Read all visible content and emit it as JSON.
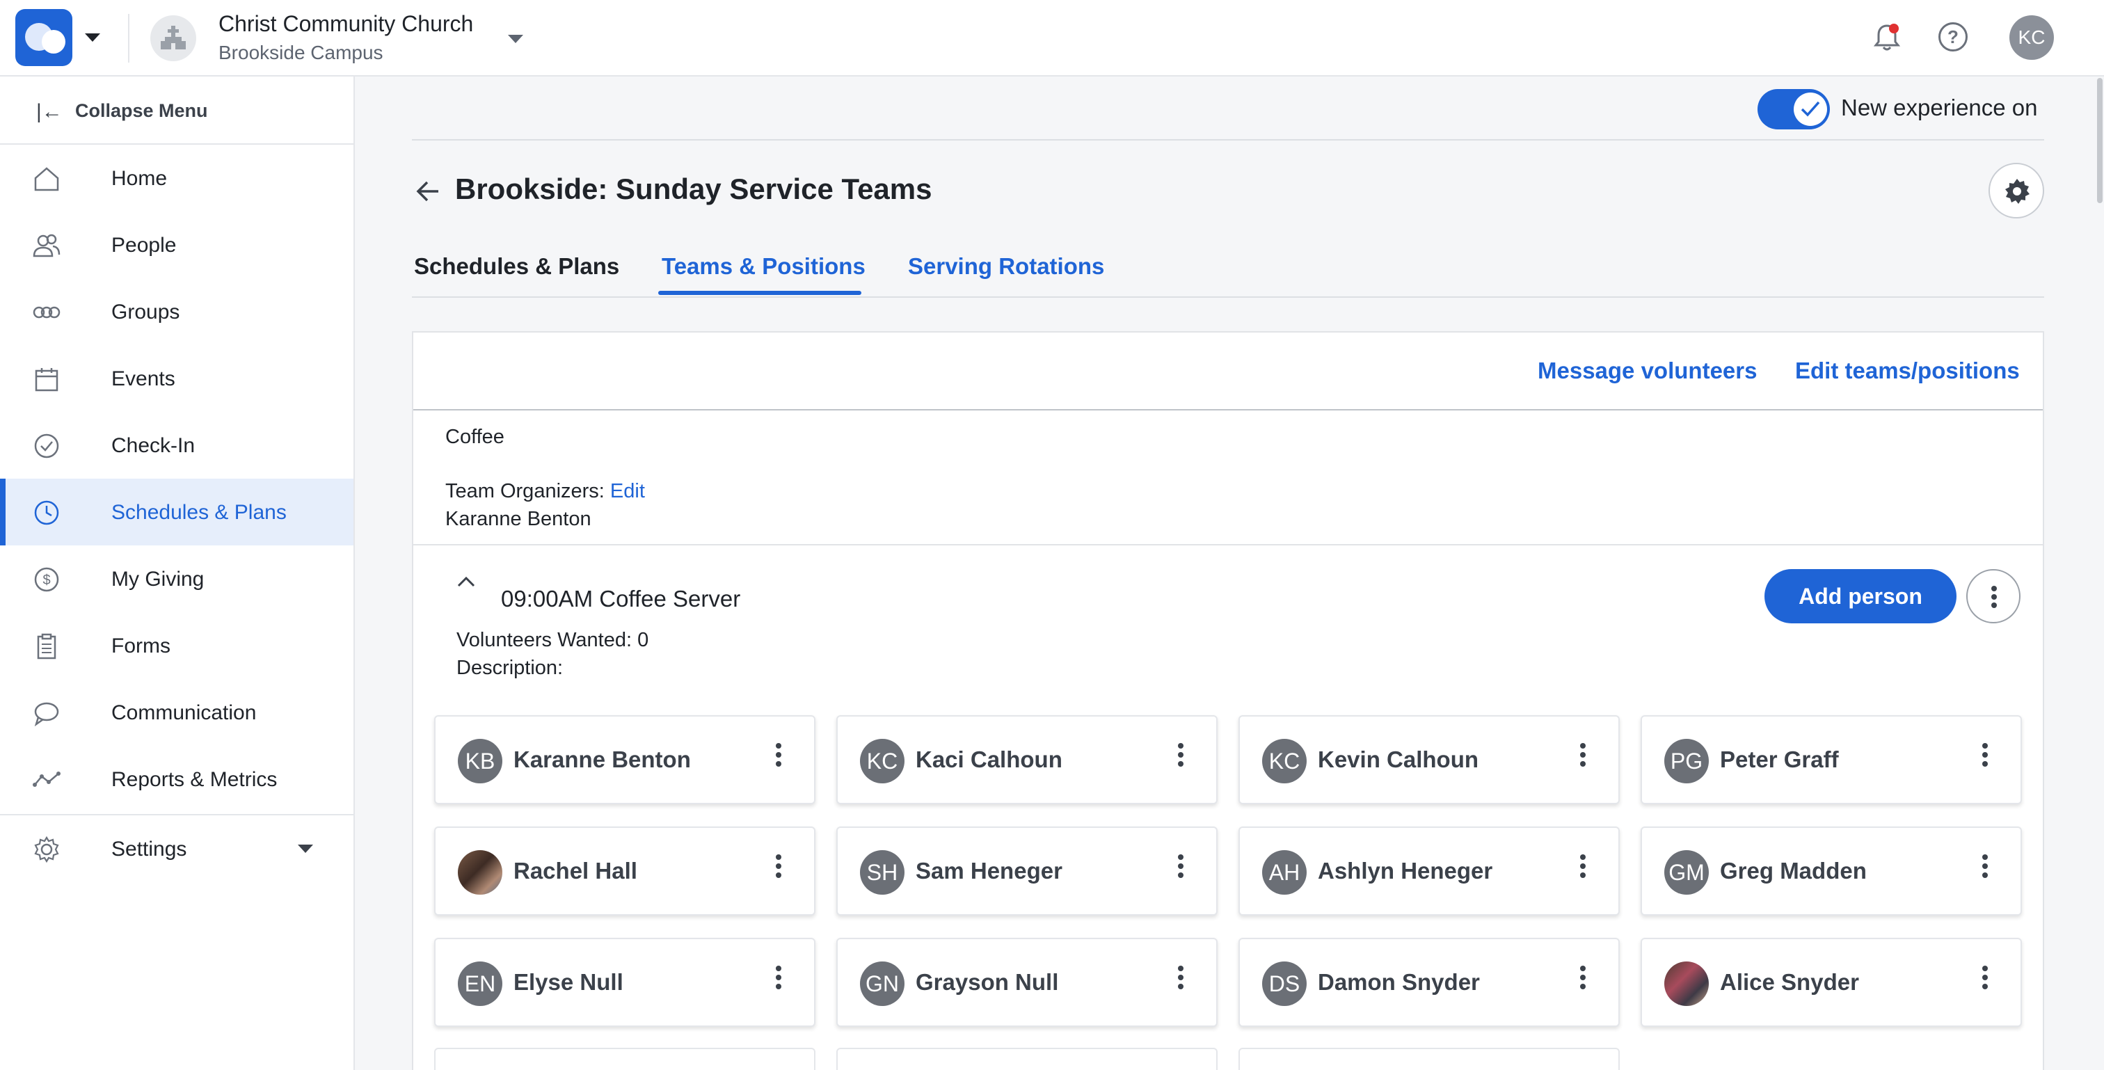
{
  "topbar": {
    "church_name": "Christ Community Church",
    "campus": "Brookside Campus",
    "user_initials": "KC",
    "notification_dot_color": "#e03131"
  },
  "sidebar": {
    "collapse_label": "Collapse Menu",
    "items": [
      {
        "label": "Home",
        "icon": "home-icon"
      },
      {
        "label": "People",
        "icon": "people-icon"
      },
      {
        "label": "Groups",
        "icon": "groups-icon"
      },
      {
        "label": "Events",
        "icon": "calendar-icon"
      },
      {
        "label": "Check-In",
        "icon": "check-circle-icon"
      },
      {
        "label": "Schedules & Plans",
        "icon": "clock-icon",
        "active": true
      },
      {
        "label": "My Giving",
        "icon": "dollar-icon"
      },
      {
        "label": "Forms",
        "icon": "clipboard-icon"
      },
      {
        "label": "Communication",
        "icon": "chat-icon"
      },
      {
        "label": "Reports & Metrics",
        "icon": "metrics-icon"
      }
    ],
    "settings_label": "Settings"
  },
  "main": {
    "toggle_label": "New experience on",
    "toggle_on": true,
    "title": "Brookside: Sunday Service Teams",
    "tabs": [
      {
        "label": "Schedules & Plans"
      },
      {
        "label": "Teams & Positions",
        "active": true
      },
      {
        "label": "Serving Rotations"
      }
    ],
    "actions": {
      "message": "Message volunteers",
      "edit": "Edit teams/positions"
    },
    "team": {
      "name": "Coffee",
      "organizers_label": "Team Organizers:",
      "organizers_edit": "Edit",
      "organizer_name": "Karanne Benton"
    },
    "position": {
      "title": "09:00AM Coffee Server",
      "add_label": "Add person",
      "volunteers_wanted": "Volunteers Wanted: 0",
      "description": "Description:"
    },
    "people": [
      {
        "initials": "KB",
        "name": "Karanne Benton"
      },
      {
        "initials": "KC",
        "name": "Kaci Calhoun"
      },
      {
        "initials": "KC",
        "name": "Kevin Calhoun"
      },
      {
        "initials": "PG",
        "name": "Peter Graff"
      },
      {
        "initials": "",
        "name": "Rachel Hall"
      },
      {
        "initials": "SH",
        "name": "Sam Heneger"
      },
      {
        "initials": "AH",
        "name": "Ashlyn Heneger"
      },
      {
        "initials": "GM",
        "name": "Greg Madden"
      },
      {
        "initials": "EN",
        "name": "Elyse Null"
      },
      {
        "initials": "GN",
        "name": "Grayson Null"
      },
      {
        "initials": "DS",
        "name": "Damon Snyder"
      },
      {
        "initials": "",
        "name": "Alice Snyder"
      }
    ],
    "accent_color": "#1f64d6"
  }
}
